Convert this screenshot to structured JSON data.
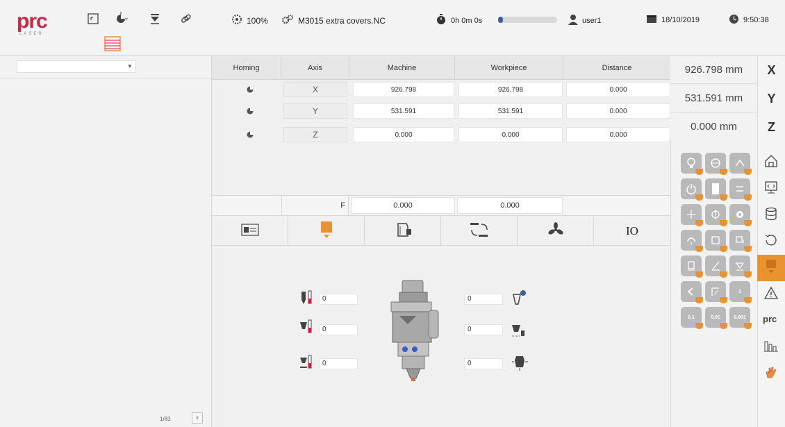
{
  "header": {
    "logo_text": "prc",
    "logo_sub": "LASER",
    "zoom": "100%",
    "program": "M3015 extra covers.NC",
    "elapsed": "0h 0m 0s",
    "progress_fraction": 0.05,
    "user": "user1",
    "date": "18/10/2019",
    "time": "9:50:38"
  },
  "left_panel": {
    "select_value": "",
    "pager": "1/83",
    "pager_button": "x"
  },
  "axes_table": {
    "columns": [
      "Homing",
      "Axis",
      "Machine",
      "Workpiece",
      "Distance"
    ],
    "rows": [
      {
        "axis": "X",
        "machine": "926.798",
        "workpiece": "926.798",
        "distance": "0.000"
      },
      {
        "axis": "Y",
        "machine": "531.591",
        "workpiece": "531.591",
        "distance": "0.000"
      },
      {
        "axis": "Z",
        "machine": "0.000",
        "workpiece": "0.000",
        "distance": "0.000"
      }
    ],
    "feed_label": "F",
    "feed_machine": "0.000",
    "feed_workpiece": "0.000"
  },
  "tabs": {
    "io_label": "IO"
  },
  "head": {
    "left_values": [
      "0",
      "0",
      "0"
    ],
    "right_values": [
      "0",
      "0",
      "0"
    ]
  },
  "readouts": [
    {
      "value": "926.798 mm",
      "axis": "X"
    },
    {
      "value": "531.591 mm",
      "axis": "Y"
    },
    {
      "value": "0.000 mm",
      "axis": "Z"
    }
  ],
  "steps": [
    "0.1",
    "0.01",
    "0.001"
  ],
  "colors": {
    "brand": "#c6294a",
    "accent": "#e8932f",
    "progress": "#3a5fa8"
  }
}
